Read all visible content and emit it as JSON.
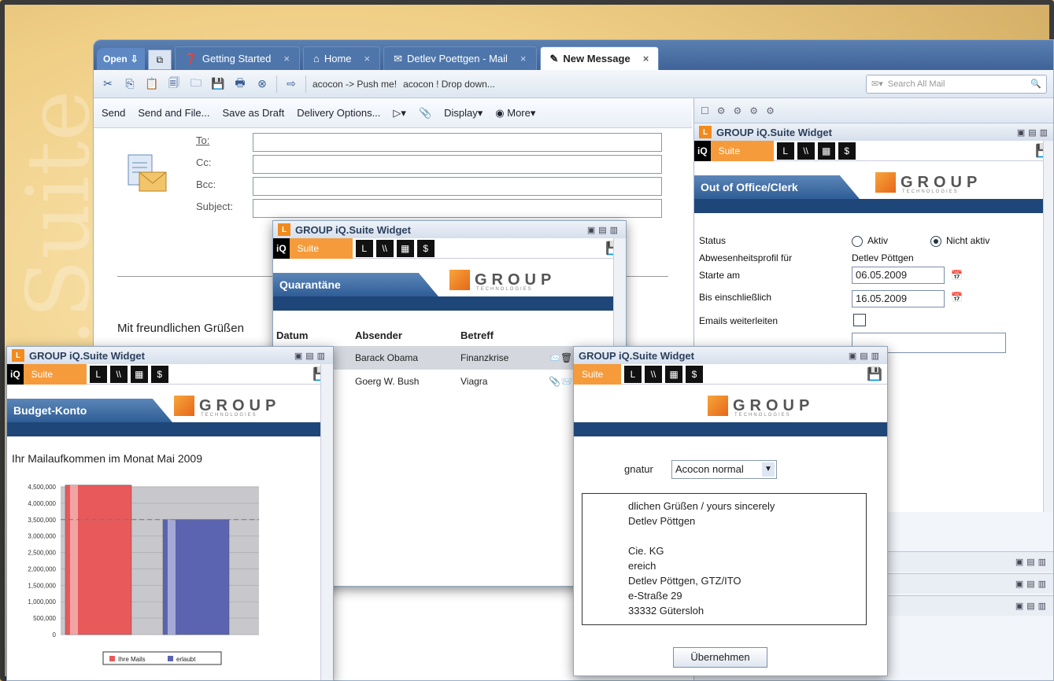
{
  "tabs": {
    "open_label": "Open",
    "items": [
      {
        "label": "Getting Started"
      },
      {
        "label": "Home"
      },
      {
        "label": "Detlev Poettgen - Mail"
      },
      {
        "label": "New Message"
      }
    ]
  },
  "toolbar": {
    "push_label": "acocon -> Push me!",
    "dropdown_label": "acocon ! Drop down...",
    "search_placeholder": "Search All Mail"
  },
  "actions": {
    "send": "Send",
    "send_file": "Send and File...",
    "save_draft": "Save as Draft",
    "delivery": "Delivery Options...",
    "display": "Display",
    "more": "More"
  },
  "compose": {
    "to": "To:",
    "cc": "Cc:",
    "bcc": "Bcc:",
    "subject": "Subject:",
    "greeting": "Mit freundlichen Grüßen"
  },
  "widget": {
    "title": "GROUP iQ.Suite Widget",
    "iq": "iQ",
    "suite": "Suite",
    "logo_text": "GROUP",
    "logo_sub": "TECHNOLOGIES"
  },
  "quarantine": {
    "heading": "Quarantäne",
    "columns": [
      "Datum",
      "Absender",
      "Betreff"
    ],
    "rows": [
      {
        "sender": "Barack Obama",
        "subject": "Finanzkrise"
      },
      {
        "sender": "Goerg W. Bush",
        "subject": "Viagra"
      }
    ]
  },
  "out_of_office": {
    "heading": "Out of Office/Clerk",
    "status_label": "Status",
    "opt_active": "Aktiv",
    "opt_inactive": "Nicht aktiv",
    "profile_label": "Abwesenheitsprofil für",
    "profile_value": "Detlev Pöttgen",
    "start_label": "Starte am",
    "start_value": "06.05.2009",
    "end_label": "Bis einschließlich",
    "end_value": "16.05.2009",
    "forward_label": "Emails weiterleiten"
  },
  "budget": {
    "heading": "Budget-Konto",
    "subtitle": "Ihr Mailaufkommen im Monat Mai 2009"
  },
  "signature": {
    "label_partial": "gnatur",
    "select_value": "Acocon normal",
    "lines": [
      "dlichen Grüßen / yours sincerely",
      "Detlev Pöttgen",
      "",
      "Cie. KG",
      "ereich",
      "Detlev Pöttgen, GTZ/ITO",
      "e-Straße 29",
      "33332 Gütersloh"
    ],
    "apply_button": "Übernehmen"
  },
  "chart_data": {
    "type": "bar",
    "categories": [
      "Ihre Mails",
      "erlaubt"
    ],
    "values": [
      4550000,
      3500000
    ],
    "ylim": [
      0,
      4500000
    ],
    "yticks": [
      "0",
      "500,000",
      "1,000,000",
      "1,500,000",
      "2,000,000",
      "2,500,000",
      "3,000,000",
      "3,500,000",
      "4,000,000",
      "4,500,000"
    ],
    "colors": [
      "#e8595b",
      "#5a64b0"
    ],
    "reference_line": 3500000,
    "legend": [
      "Ihre Mails",
      "erlaubt"
    ]
  }
}
